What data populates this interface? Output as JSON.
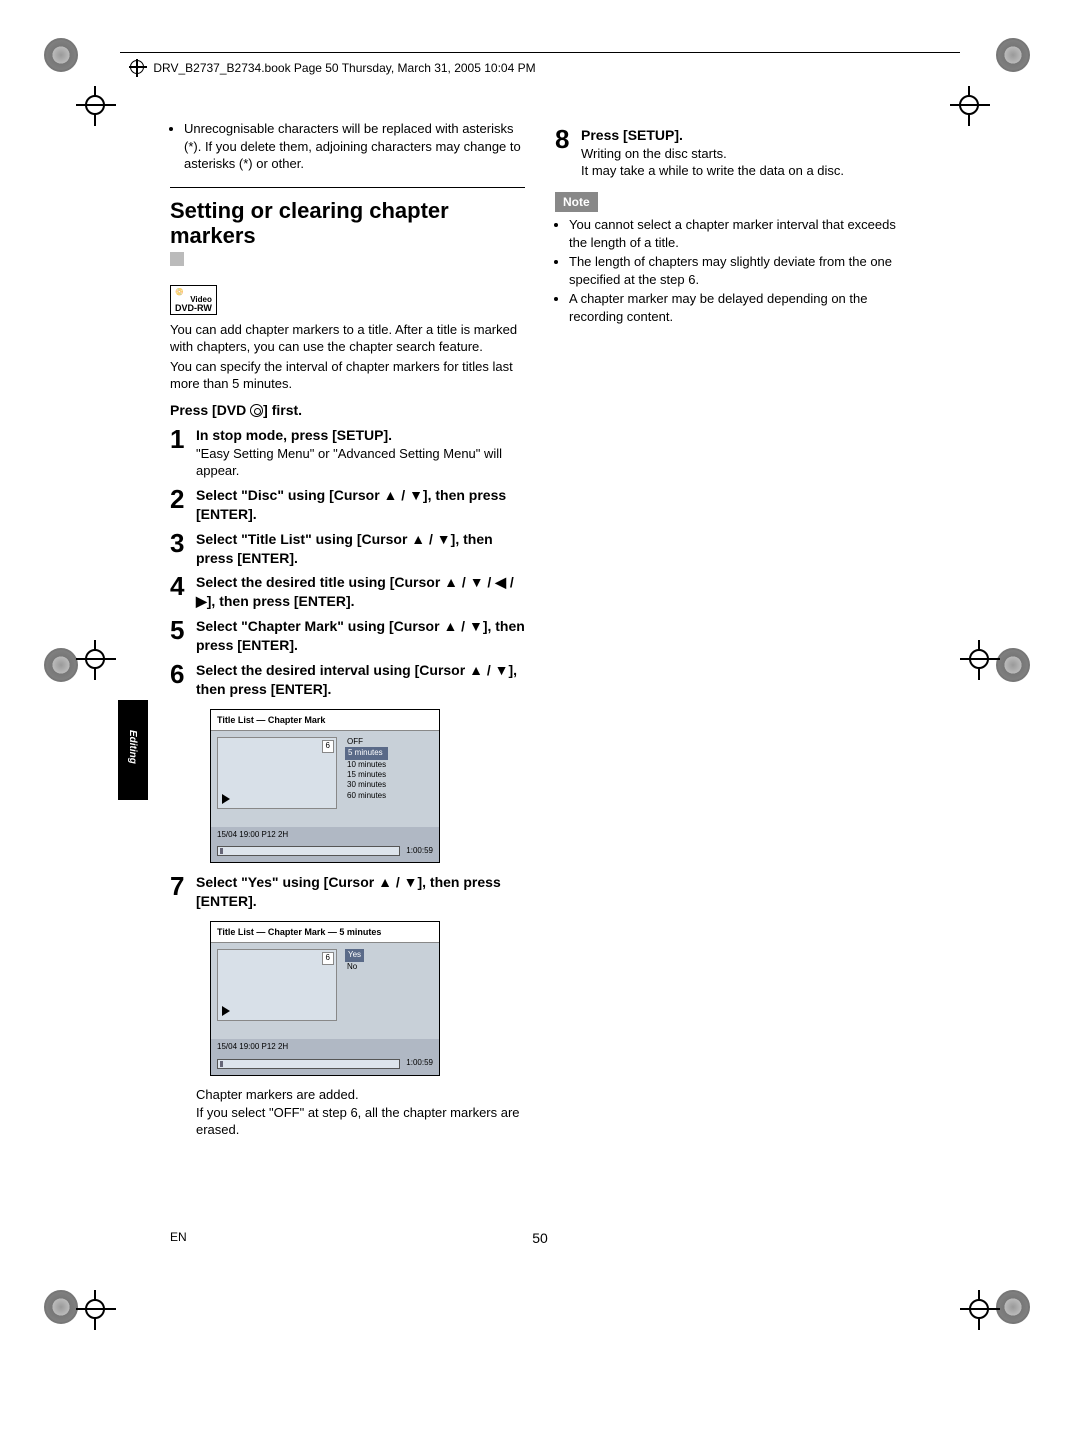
{
  "header": {
    "running": "DRV_B2737_B2734.book  Page 50  Thursday, March 31, 2005  10:04 PM"
  },
  "sideTab": "Editing",
  "footer": {
    "en": "EN",
    "page": "50"
  },
  "left": {
    "topBullet": "Unrecognisable characters will be replaced with asterisks (*). If you delete them, adjoining characters may change to asterisks (*) or other.",
    "sectionTitle": "Setting or clearing chapter markers",
    "dvdBadge": {
      "line1": "Video",
      "line2": "DVD-RW"
    },
    "intro1": "You can add chapter markers to a title. After a title is marked with chapters, you can use the chapter search feature.",
    "intro2": "You can specify the interval of chapter markers for titles last more than 5 minutes.",
    "pressFirst": "Press [DVD ⦿] first.",
    "steps": [
      {
        "n": "1",
        "t": "In stop mode, press [SETUP].",
        "b": "\"Easy Setting Menu\" or \"Advanced Setting Menu\" will appear."
      },
      {
        "n": "2",
        "t": "Select \"Disc\" using [Cursor ▲ / ▼], then press [ENTER]."
      },
      {
        "n": "3",
        "t": "Select \"Title List\" using [Cursor ▲ / ▼], then press [ENTER]."
      },
      {
        "n": "4",
        "t": "Select the desired title using [Cursor ▲ / ▼ / ◀ / ▶], then press [ENTER]."
      },
      {
        "n": "5",
        "t": "Select \"Chapter Mark\" using [Cursor ▲ / ▼], then press [ENTER]."
      },
      {
        "n": "6",
        "t": "Select the desired interval using [Cursor ▲ / ▼], then press [ENTER]."
      },
      {
        "n": "7",
        "t": "Select \"Yes\" using [Cursor ▲ / ▼], then press [ENTER]."
      }
    ],
    "screen1": {
      "title": "Title List — Chapter Mark",
      "thumbNum": "6",
      "options": [
        "OFF",
        "5 minutes",
        "10 minutes",
        "15 minutes",
        "30 minutes",
        "60 minutes"
      ],
      "selectedIndex": 1,
      "foot": "15/04  19:00  P12  2H",
      "time": "1:00:59"
    },
    "afterScreen1Note": "",
    "screen2": {
      "title": "Title List — Chapter Mark — 5 minutes",
      "thumbNum": "6",
      "options": [
        "Yes",
        "No"
      ],
      "selectedIndex": 0,
      "foot": "15/04  19:00  P12  2H",
      "time": "1:00:59"
    },
    "afterScreen2a": "Chapter markers are added.",
    "afterScreen2b": "If you select \"OFF\" at step 6, all the chapter markers are erased."
  },
  "right": {
    "step8n": "8",
    "step8t": "Press [SETUP].",
    "step8b1": "Writing on the disc starts.",
    "step8b2": "It may take a while to write the data on a disc.",
    "noteLabel": "Note",
    "notes": [
      "You cannot select a chapter marker interval that exceeds the length of a title.",
      "The length of chapters may slightly deviate from the one specified at the step 6.",
      "A chapter marker may be delayed depending on the recording content."
    ]
  }
}
